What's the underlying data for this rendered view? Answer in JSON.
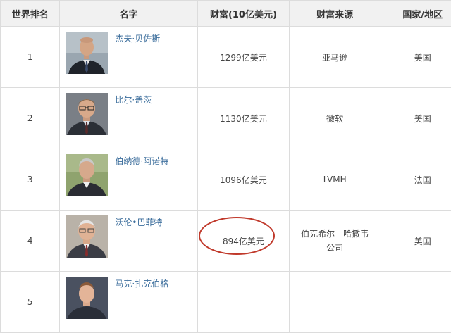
{
  "headers": {
    "rank": "世界排名",
    "name": "名字",
    "wealth": "财富(10亿美元)",
    "source": "财富来源",
    "country": "国家/地区"
  },
  "rows": [
    {
      "rank": "1",
      "name": "杰夫·贝佐斯",
      "wealth": "1299亿美元",
      "source": "亚马逊",
      "country": "美国",
      "photo_icon": "bezos-photo"
    },
    {
      "rank": "2",
      "name": "比尔·盖茨",
      "wealth": "1130亿美元",
      "source": "微软",
      "country": "美国",
      "photo_icon": "gates-photo"
    },
    {
      "rank": "3",
      "name": "伯纳德·阿诺特",
      "wealth": "1096亿美元",
      "source": "LVMH",
      "country": "法国",
      "photo_icon": "arnault-photo"
    },
    {
      "rank": "4",
      "name": "沃伦•巴菲特",
      "wealth": "894亿美元",
      "source_line1": "伯克希尔 - 哈撒韦",
      "source_line2": "公司",
      "country": "美国",
      "photo_icon": "buffett-photo"
    },
    {
      "rank": "5",
      "name": "马克·扎克伯格",
      "wealth": "",
      "source": "",
      "country": "",
      "photo_icon": "zuckerberg-photo"
    }
  ],
  "highlight_color": "#c0392b"
}
